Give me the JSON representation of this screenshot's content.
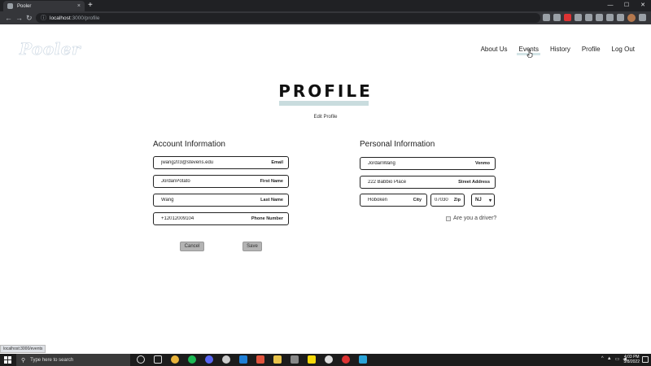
{
  "browser": {
    "tab_title": "Pooler",
    "tab_close": "×",
    "new_tab": "+",
    "url_host": "localhost",
    "url_rest": ":3000/profile",
    "window_controls": [
      "—",
      "☐",
      "✕"
    ]
  },
  "site": {
    "logo": "Pooler",
    "nav": [
      {
        "label": "About Us"
      },
      {
        "label": "Events"
      },
      {
        "label": "History"
      },
      {
        "label": "Profile"
      },
      {
        "label": "Log Out"
      }
    ]
  },
  "profile": {
    "heading": "PROFILE",
    "edit_link": "Edit Profile",
    "account": {
      "title": "Account Information",
      "fields": [
        {
          "value": "jwang203@stevens.edu",
          "label": "Email"
        },
        {
          "value": "JordanPotato",
          "label": "First Name"
        },
        {
          "value": "Wang",
          "label": "Last Name"
        },
        {
          "value": "+12012009104",
          "label": "Phone Number"
        }
      ]
    },
    "personal": {
      "title": "Personal Information",
      "venmo": {
        "value": "JordanWang",
        "label": "Venmo"
      },
      "street": {
        "value": "222 Babbio Place",
        "label": "Street Address"
      },
      "city": {
        "value": "Hoboken",
        "label": "City"
      },
      "zip": {
        "value": "07030",
        "label": "Zip"
      },
      "state": {
        "value": "NJ"
      },
      "driver_label": "Are you a driver?",
      "driver_checked": false
    },
    "buttons": {
      "cancel": "Cancel",
      "save": "Save"
    }
  },
  "status_url": "localhost:3000/events",
  "taskbar": {
    "search_placeholder": "Type here to search",
    "time": "4:03 PM",
    "date": "5/8/2022"
  },
  "colors": {
    "accent_bar": "#c9dcde",
    "button_bg": "#b3b3b3",
    "logo_outline": "#c9d5e1"
  }
}
